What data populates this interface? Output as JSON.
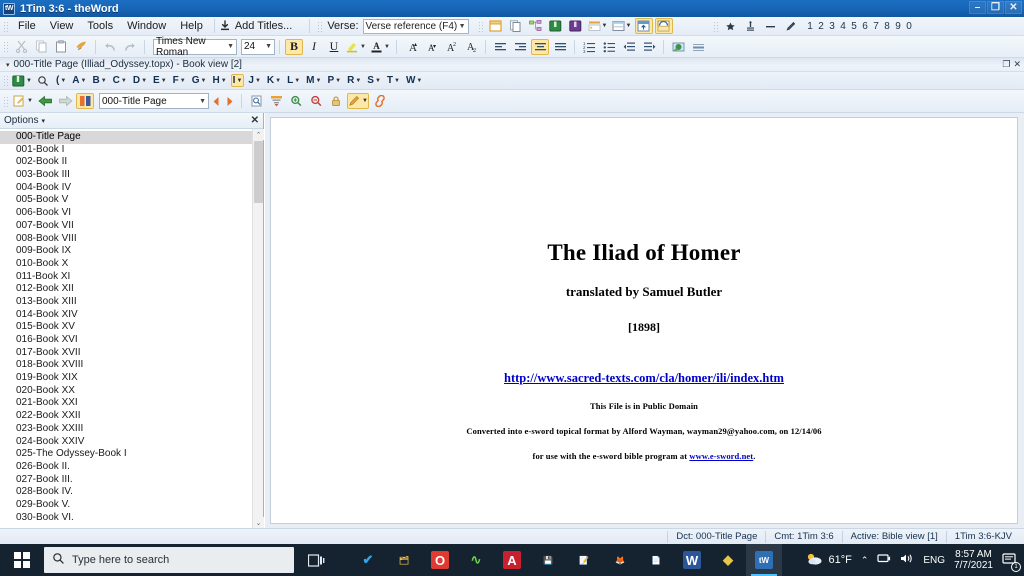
{
  "window": {
    "title": "1Tim 3:6 - theWord",
    "logo_text": "tW",
    "minimize": "–",
    "restore": "❐",
    "close": "✕"
  },
  "menubar": {
    "items": [
      {
        "label": "File"
      },
      {
        "label": "View"
      },
      {
        "label": "Tools"
      },
      {
        "label": "Window"
      },
      {
        "label": "Help"
      }
    ],
    "add_titles_label": "Add Titles...",
    "add_titles_icon": "download-icon",
    "verse_label": "Verse:",
    "verse_value": "Verse reference (F4)",
    "verse_options": [
      "Verse reference (F4)"
    ],
    "right_icons": [
      "bookmark-icon",
      "footnote-icon",
      "strikethrough-icon",
      "pencil-icon"
    ],
    "number_buttons": [
      "1",
      "2",
      "3",
      "4",
      "5",
      "6",
      "7",
      "8",
      "9",
      "0"
    ],
    "toolbar_icons": [
      "new-window-icon",
      "copy-icon",
      "hierarchy-icon",
      "green-book-icon",
      "purple-book-icon",
      "layout-icon",
      "window-split-icon",
      "dock-top-icon",
      "dock-float-icon"
    ]
  },
  "format_toolbar": {
    "cut_icon": "cut-icon",
    "copy_icon": "copy-icon",
    "paste_icon": "paste-icon",
    "format_painter_icon": "format-painter-icon",
    "undo_icon": "undo-icon",
    "redo_icon": "redo-icon",
    "font_name": "Times New Roman",
    "font_size": "24",
    "bold_label": "B",
    "italic_label": "I",
    "underline_label": "U",
    "highlight_icon": "highlight-color-icon",
    "font_color_icon": "font-color-icon",
    "grow_font_label": "A",
    "shrink_font_label": "A",
    "superscript_label": "A",
    "subscript_label": "A",
    "align_left_icon": "align-left-icon",
    "align_center_icon": "align-center-icon",
    "align_justify_icon": "align-justify-icon",
    "align_right_icon": "align-right-icon",
    "numbered_list_icon": "numbered-list-icon",
    "bullet_list_icon": "bullet-list-icon",
    "outdent_icon": "outdent-icon",
    "indent_icon": "indent-icon",
    "insert_image_icon": "insert-image-icon",
    "insert_hr_icon": "insert-horizontal-rule-icon"
  },
  "doc_tab": {
    "title": "000-Title Page (Illiad_Odyssey.topx) - Book view [2]",
    "restore_btn": "❐",
    "close_btn": "✕"
  },
  "alpha_bar": {
    "book_icon": "green-book-icon",
    "search_icon": "magnifier-icon",
    "paren_label": "(",
    "letters": [
      "A",
      "B",
      "C",
      "D",
      "E",
      "F",
      "G",
      "H",
      "I",
      "J",
      "K",
      "L",
      "M",
      "P",
      "R",
      "S",
      "T",
      "W"
    ],
    "active_letter": "I"
  },
  "nav_toolbar": {
    "edit_icon": "edit-note-icon",
    "back_icon": "back-arrow-icon",
    "forward_icon": "forward-arrow-icon",
    "book_icon": "open-book-icon",
    "page_value": "000-Title Page",
    "prev_icon": "prev-topic-icon",
    "next_icon": "next-topic-icon",
    "find_icon": "find-in-page-icon",
    "tree_icon": "collapse-tree-icon",
    "zoom_in_icon": "zoom-in-icon",
    "zoom_out_icon": "zoom-out-icon",
    "lock_icon": "lock-icon",
    "pencil_icon": "edit-pencil-icon",
    "link_icon": "link-icon"
  },
  "left_panel": {
    "options_label": "Options",
    "options_caret": "▾",
    "close_label": "✕",
    "selected_index": 0,
    "items": [
      "000-Title Page",
      "001-Book I",
      "002-Book II",
      "003-Book III",
      "004-Book IV",
      "005-Book V",
      "006-Book VI",
      "007-Book VII",
      "008-Book VIII",
      "009-Book IX",
      "010-Book X",
      "011-Book XI",
      "012-Book XII",
      "013-Book XIII",
      "014-Book XIV",
      "015-Book XV",
      "016-Book XVI",
      "017-Book XVII",
      "018-Book XVIII",
      "019-Book XIX",
      "020-Book XX",
      "021-Book XXI",
      "022-Book XXII",
      "023-Book XXIII",
      "024-Book XXIV",
      "025-The Odyssey-Book I",
      "026-Book II.",
      "027-Book III.",
      "028-Book IV.",
      "029-Book V.",
      "030-Book VI."
    ],
    "scroll_up": "⌃",
    "scroll_down": "⌄"
  },
  "document": {
    "title": "The Iliad of Homer",
    "subtitle": "translated by Samuel Butler",
    "year": "[1898]",
    "source_url": "http://www.sacred-texts.com/cla/homer/ili/index.htm",
    "public_domain": "This File is in Public Domain",
    "converted_prefix": "Converted into e-sword topical format by Alford Wayman,  wayman29@yahoo.com, on 12/14/06",
    "use_with_prefix": "for use with the e-sword bible program at ",
    "use_with_link": "www.e-sword.net",
    "use_with_suffix": "."
  },
  "status_bar": {
    "dct": "Dct: 000-Title Page",
    "cmt": "Cmt: 1Tim 3:6",
    "active": "Active: Bible view [1]",
    "ref": "1Tim 3:6-KJV"
  },
  "taskbar": {
    "start_icon": "windows-start-icon",
    "search_placeholder": "Type here to search",
    "search_icon": "search-icon",
    "task_view_icon": "task-view-icon",
    "apps": [
      {
        "name": "todo-app-icon",
        "glyph": "✔",
        "color": "#2fa8e8",
        "bg": "transparent",
        "running": false
      },
      {
        "name": "file-explorer-icon",
        "glyph": "🗂",
        "color": "#f0c04a",
        "bg": "transparent",
        "running": false
      },
      {
        "name": "opera-icon",
        "glyph": "O",
        "color": "#ffffff",
        "bg": "#e03a32",
        "running": false
      },
      {
        "name": "chart-app-icon",
        "glyph": "∿",
        "color": "#6ed24a",
        "bg": "transparent",
        "running": true
      },
      {
        "name": "adobe-acrobat-icon",
        "glyph": "A",
        "color": "#ffffff",
        "bg": "#c8202e",
        "running": true
      },
      {
        "name": "save-disk-icon",
        "glyph": "💾",
        "color": "#7fb8e8",
        "bg": "transparent",
        "running": true
      },
      {
        "name": "notepad-editor-icon",
        "glyph": "📝",
        "color": "#8fd14f",
        "bg": "transparent",
        "running": true
      },
      {
        "name": "firefox-icon",
        "glyph": "🦊",
        "color": "#ff7b2e",
        "bg": "transparent",
        "running": true
      },
      {
        "name": "document-viewer-icon",
        "glyph": "📄",
        "color": "#4a9fe0",
        "bg": "transparent",
        "running": true
      },
      {
        "name": "microsoft-word-icon",
        "glyph": "W",
        "color": "#ffffff",
        "bg": "#2b579a",
        "running": true
      },
      {
        "name": "logos-app-icon",
        "glyph": "◆",
        "color": "#e8c547",
        "bg": "transparent",
        "running": true
      },
      {
        "name": "theword-app-icon",
        "glyph": "tW",
        "color": "#ffffff",
        "bg": "#2f6fb5",
        "running": true,
        "active": true
      }
    ],
    "tray": {
      "weather_icon": "partly-cloudy-icon",
      "temperature": "61°F",
      "chevron": "⌃",
      "network_icon": "network-icon",
      "volume_icon": "volume-icon",
      "language": "ENG",
      "time": "8:57 AM",
      "date": "7/7/2021",
      "notification_icon": "notification-icon",
      "notification_count": "1"
    }
  }
}
